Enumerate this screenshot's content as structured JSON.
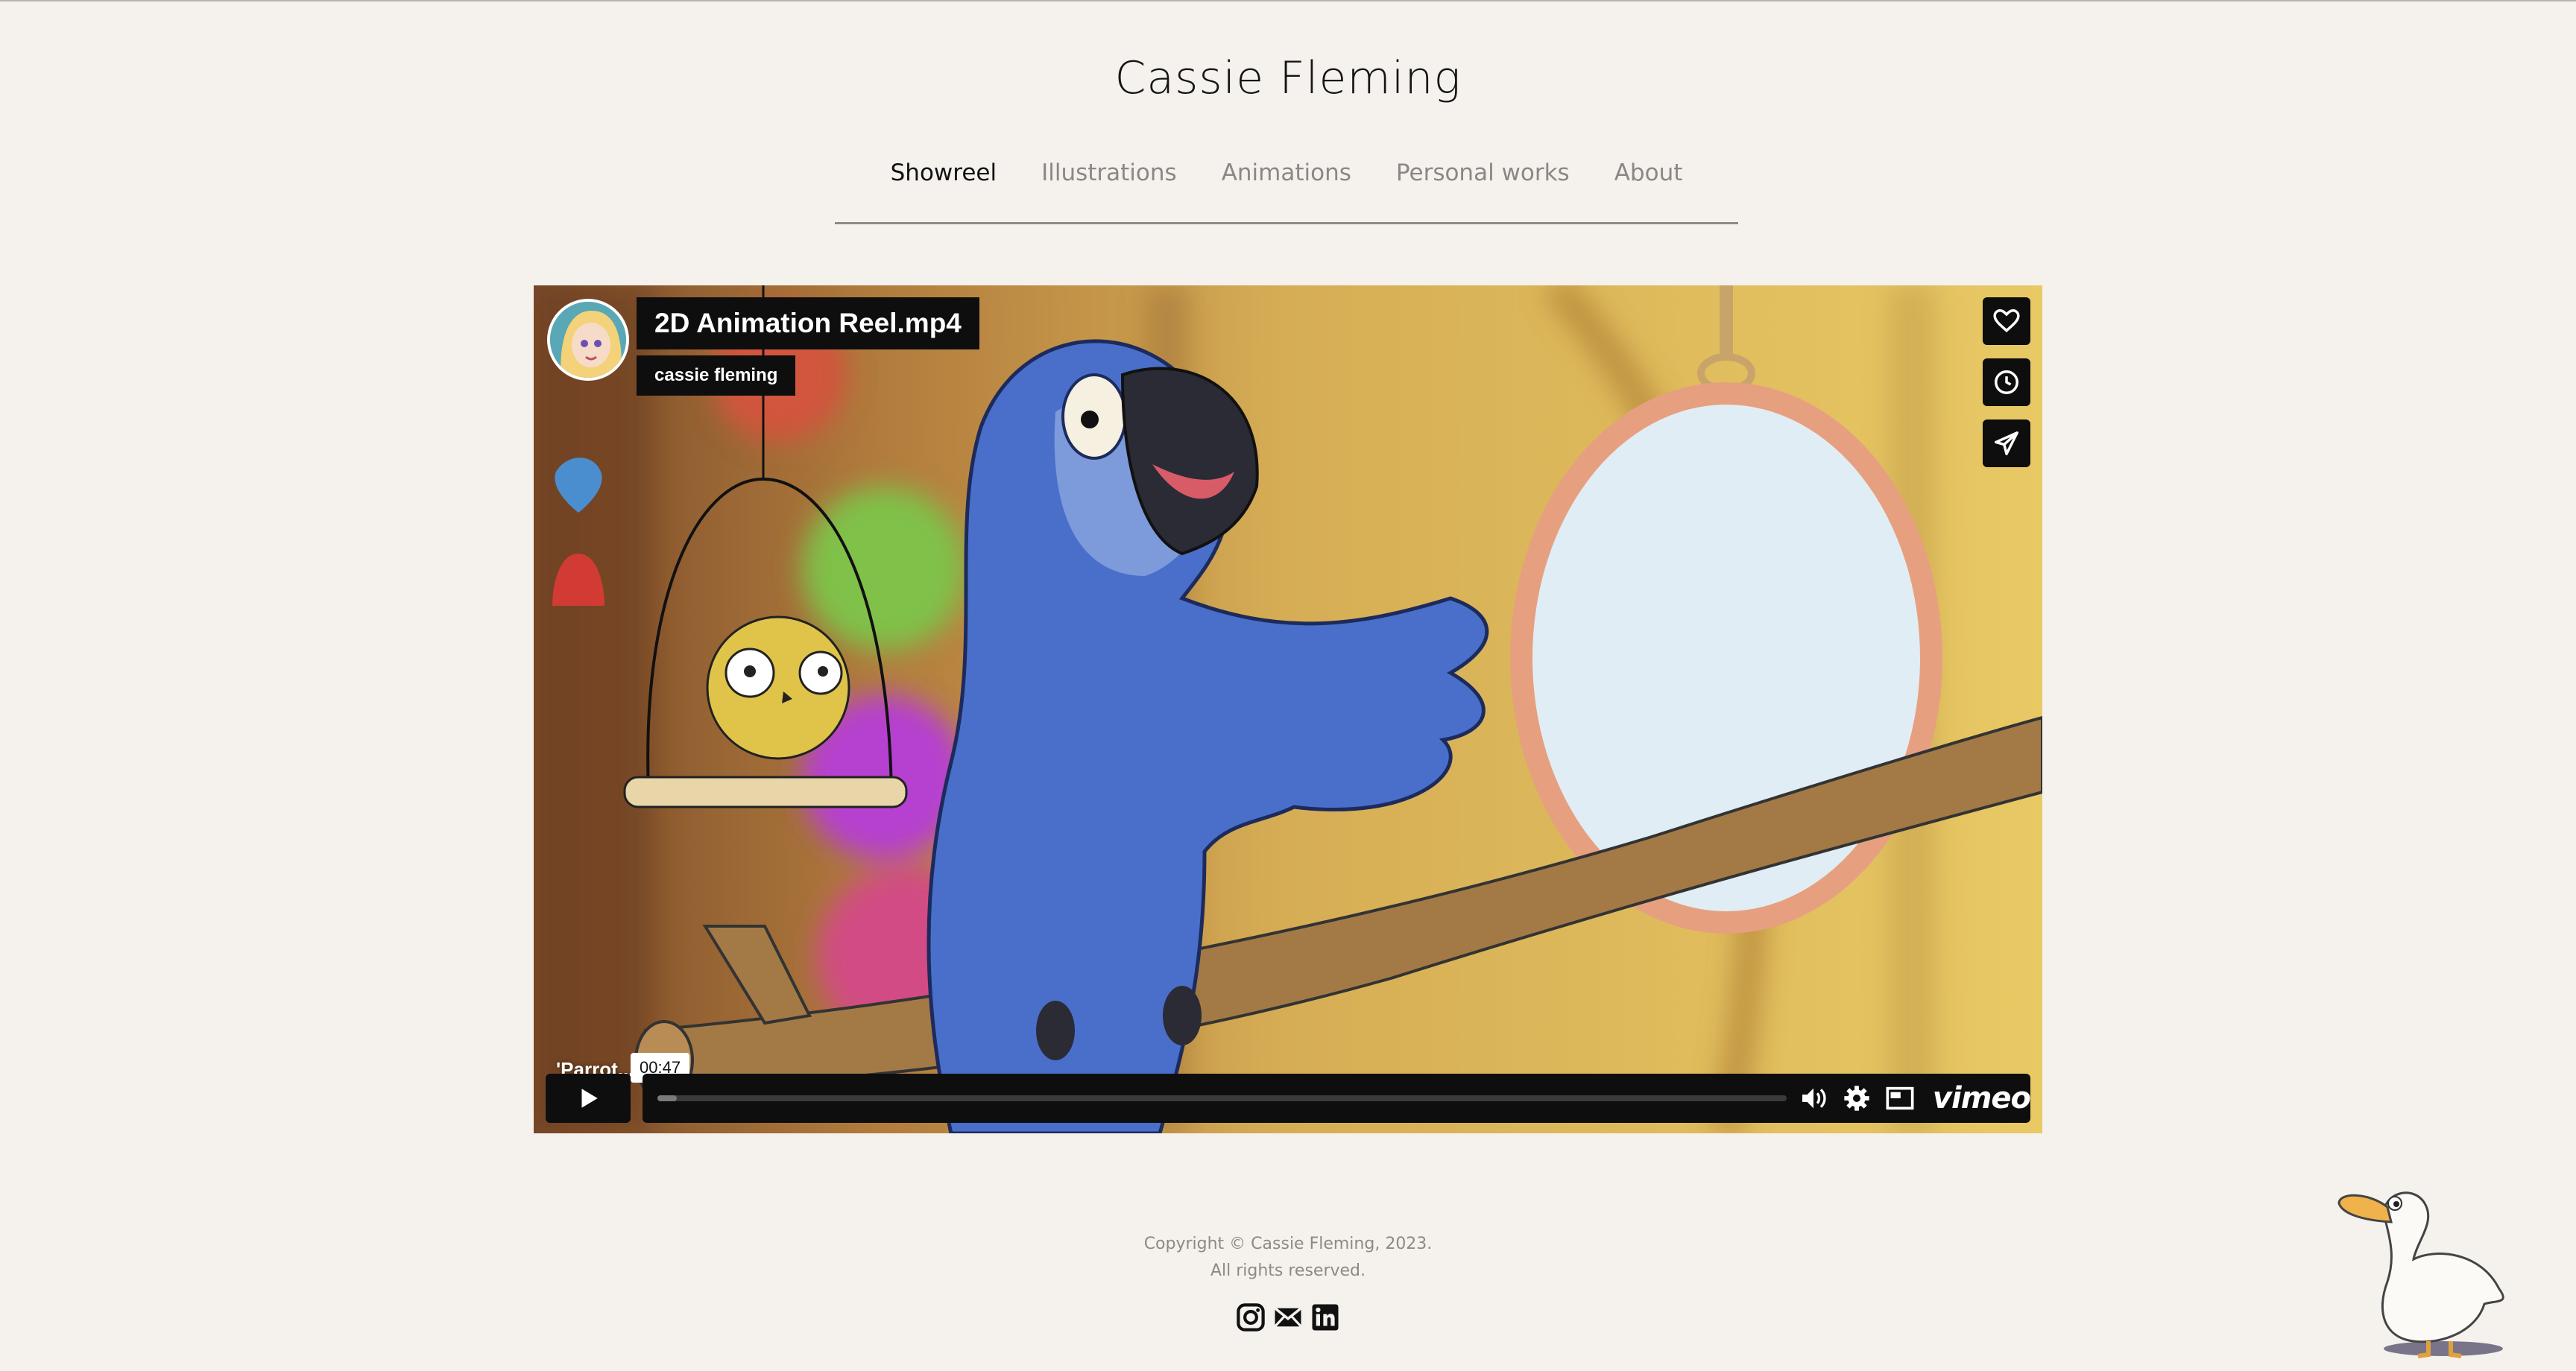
{
  "site": {
    "title": "Cassie Fleming"
  },
  "nav": {
    "items": [
      {
        "label": "Showreel",
        "active": true
      },
      {
        "label": "Illustrations",
        "active": false
      },
      {
        "label": "Animations",
        "active": false
      },
      {
        "label": "Personal works",
        "active": false
      },
      {
        "label": "About",
        "active": false
      }
    ]
  },
  "player": {
    "video_title": "2D Animation Reel.mp4",
    "author": "cassie fleming",
    "overlay_caption": "'Parrot... sion'",
    "timestamp": "00:47",
    "progress_fraction": 0.017,
    "brand": "vimeo",
    "side_buttons": [
      "heart-icon",
      "clock-icon",
      "send-icon"
    ],
    "controls": [
      "volume-icon",
      "settings-icon",
      "pip-icon"
    ]
  },
  "footer": {
    "copyright": "Copyright © Cassie Fleming, 2023.",
    "rights": "All rights reserved.",
    "social": [
      "instagram-icon",
      "mail-icon",
      "linkedin-icon"
    ]
  },
  "colors": {
    "background": "#f5f2ee",
    "player_bar": "#0e0e0e",
    "parrot_blue": "#4a6fcb"
  }
}
